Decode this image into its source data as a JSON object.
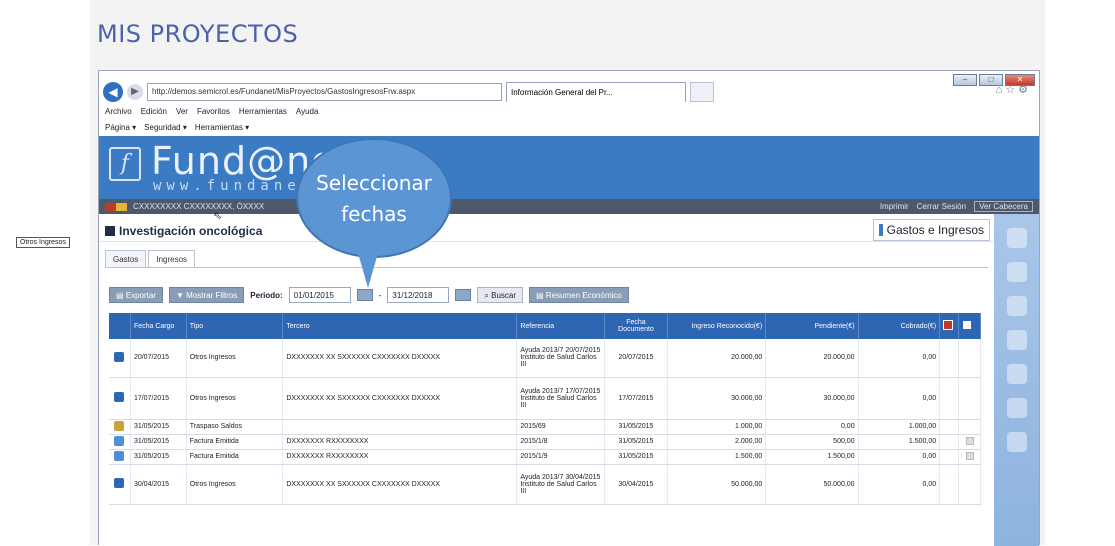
{
  "page": {
    "heading": "MIS PROYECTOS"
  },
  "browser": {
    "url": "http://demos.semicrol.es/Fundanet/MisProyectos/GastosIngresosFrw.aspx",
    "tab_title": "Información General del Pr...",
    "menu": [
      "Archivo",
      "Edición",
      "Ver",
      "Favoritos",
      "Herramientas",
      "Ayuda"
    ],
    "commands": [
      "Página ▾",
      "Seguridad ▾",
      "Herramientas ▾"
    ],
    "icons": [
      "home-icon",
      "star-icon",
      "gear-icon"
    ]
  },
  "banner": {
    "logo_text": "Fund@net",
    "logo_url": "www.fundanet.e",
    "user": "CXXXXXXXX CXXXXXXXX, ÓXXXX",
    "imprimir": "Imprimir",
    "cerrar": "Cerrar Sesión",
    "ver_cabecera": "Ver Cabecera"
  },
  "panel": {
    "title": "Investigación oncológica",
    "gastos_ingresos": "Gastos e Ingresos",
    "tabs": [
      "Gastos",
      "Ingresos"
    ],
    "active_tab": "Ingresos"
  },
  "toolbar": {
    "exportar": "Exportar",
    "mostrar_filtros": "Mostrar Filtros",
    "periodo_label": "Periodo:",
    "date_from": "01/01/2015",
    "date_sep": "-",
    "date_to": "31/12/2018",
    "buscar": "Buscar",
    "resumen": "Resumen Económico"
  },
  "table": {
    "headers": [
      "Fecha Cargo",
      "Tipo",
      "Tercero",
      "Referencia",
      "Fecha Documento",
      "Ingreso Reconocido(€)",
      "Pendiente(€)",
      "Cobrado(€)"
    ],
    "rows": [
      {
        "fecha": "20/07/2015",
        "tipo": "Otros Ingresos",
        "tercero": "DXXXXXXX XX SXXXXXX CXXXXXXX DXXXXX",
        "referencia": "Ayuda 2013/7 20/07/2015 Instituto de Salud Carlos III",
        "fecha_doc": "20/07/2015",
        "ingreso": "20.000,00",
        "pendiente": "20.000,00",
        "cobrado": "0,00"
      },
      {
        "fecha": "17/07/2015",
        "tipo": "Otros Ingresos",
        "tercero": "DXXXXXXX XX SXXXXXX CXXXXXXX DXXXXX",
        "referencia": "Ayuda 2013/7 17/07/2015 Instituto de Salud Carlos III",
        "fecha_doc": "17/07/2015",
        "ingreso": "30.000,00",
        "pendiente": "30.000,00",
        "cobrado": "0,00"
      },
      {
        "fecha": "31/05/2015",
        "tipo": "Traspaso Saldos",
        "tercero": "",
        "referencia": "2015/69",
        "fecha_doc": "31/05/2015",
        "ingreso": "1.000,00",
        "pendiente": "0,00",
        "cobrado": "1.000,00"
      },
      {
        "fecha": "31/05/2015",
        "tipo": "Factura Emitida",
        "tercero": "DXXXXXXX RXXXXXXXX",
        "referencia": "2015/1/8",
        "fecha_doc": "31/05/2015",
        "ingreso": "2.000,00",
        "pendiente": "500,00",
        "cobrado": "1.500,00"
      },
      {
        "fecha": "31/05/2015",
        "tipo": "Factura Emitida",
        "tercero": "DXXXXXXX RXXXXXXXX",
        "referencia": "2015/1/9",
        "fecha_doc": "31/05/2015",
        "ingreso": "1.500,00",
        "pendiente": "1.500,00",
        "cobrado": "0,00"
      },
      {
        "fecha": "30/04/2015",
        "tipo": "Otros Ingresos",
        "tercero": "DXXXXXXX XX SXXXXXX CXXXXXXX DXXXXX",
        "referencia": "Ayuda 2013/7 30/04/2015 Instituto de Salud Carlos III",
        "fecha_doc": "30/04/2015",
        "ingreso": "50.000,00",
        "pendiente": "50.000,00",
        "cobrado": "0,00"
      }
    ]
  },
  "tooltip": "Otros Ingresos",
  "callout": {
    "line1": "Seleccionar",
    "line2": "fechas"
  },
  "colors": {
    "banner": "#3a7bc3",
    "header": "#2f66b3",
    "callout": "#5b95d4"
  }
}
